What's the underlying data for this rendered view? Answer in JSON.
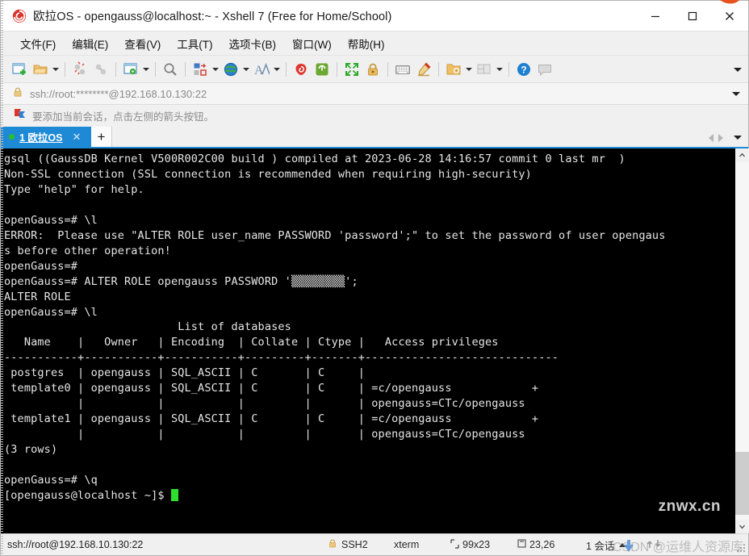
{
  "window": {
    "title": "欧拉OS - opengauss@localhost:~ - Xshell 7 (Free for Home/School)",
    "logo_icon": "xshell-logo-icon",
    "minimize_label": "—",
    "maximize_label": "□",
    "close_label": "✕"
  },
  "menu": {
    "items": [
      {
        "label": "文件(F)",
        "name": "menu-file"
      },
      {
        "label": "编辑(E)",
        "name": "menu-edit"
      },
      {
        "label": "查看(V)",
        "name": "menu-view"
      },
      {
        "label": "工具(T)",
        "name": "menu-tools"
      },
      {
        "label": "选项卡(B)",
        "name": "menu-tab"
      },
      {
        "label": "窗口(W)",
        "name": "menu-window"
      },
      {
        "label": "帮助(H)",
        "name": "menu-help"
      }
    ]
  },
  "toolbar": {
    "icons": [
      "new-session-icon",
      "open-folder-icon",
      "disconnect-icon",
      "reconnect-icon",
      "session-properties-icon",
      "find-icon",
      "transfer-file-icon",
      "globe-icon",
      "font-icon",
      "highlight-icon",
      "script-icon",
      "fullscreen-icon",
      "lock-icon",
      "keyboard-icon",
      "compose-icon",
      "add-folder-icon",
      "layout-icon",
      "help-icon",
      "chat-icon"
    ],
    "overflow_label": "▾"
  },
  "address": {
    "lock_icon": "lock-icon",
    "value": "ssh://root:********@192.168.10.130:22",
    "placeholder": "ssh://",
    "dropdown_label": "▾"
  },
  "hint": {
    "icon": "arrow-flag-icon",
    "text": "要添加当前会话，点击左侧的箭头按钮。"
  },
  "tabs": {
    "active": {
      "label": "1 欧拉OS",
      "status_dot": "connected-dot",
      "close_label": "✕"
    },
    "add_label": "+",
    "nav_prev": "◀",
    "nav_next": "▶",
    "nav_list": "▾"
  },
  "terminal": {
    "cursor_color": "#2ee02e",
    "lines": [
      "gsql ((GaussDB Kernel V500R002C00 build ) compiled at 2023-06-28 14:16:57 commit 0 last mr  )",
      "Non-SSL connection (SSL connection is recommended when requiring high-security)",
      "Type \"help\" for help.",
      "",
      "openGauss=# \\l",
      "ERROR:  Please use \"ALTER ROLE user_name PASSWORD 'password';\" to set the password of user opengaus",
      "s before other operation!",
      "openGauss=#",
      "openGauss=# ALTER ROLE opengauss PASSWORD '▒▒▒▒▒▒▒▒';",
      "ALTER ROLE",
      "openGauss=# \\l",
      "                          List of databases",
      "   Name    |   Owner   | Encoding  | Collate | Ctype |   Access privileges",
      "-----------+-----------+-----------+---------+-------+-----------------------------",
      " postgres  | opengauss | SQL_ASCII | C       | C     |",
      " template0 | opengauss | SQL_ASCII | C       | C     | =c/opengauss            +",
      "           |           |           |         |       | opengauss=CTc/opengauss",
      " template1 | opengauss | SQL_ASCII | C       | C     | =c/opengauss            +",
      "           |           |           |         |       | opengauss=CTc/opengauss",
      "(3 rows)",
      "",
      "openGauss=# \\q"
    ],
    "prompt_line": "[opengauss@localhost ~]$ "
  },
  "scrollbar": {
    "up_label": "⌃",
    "down_label": "⌄"
  },
  "statusbar": {
    "url": "ssh://root@192.168.10.130:22",
    "security_icon": "lock-icon",
    "security": "SSH2",
    "term_type": "xterm",
    "size_icon": "size-icon",
    "size": "99x23",
    "position_icon": "cursor-icon",
    "position": "23,26",
    "sessions": "1 会话",
    "sessions_caret": "▴",
    "transfer_icon": "upload-download-icon"
  },
  "watermarks": {
    "primary": "znwx.cn",
    "secondary": "CSDN @运维人资源库"
  }
}
